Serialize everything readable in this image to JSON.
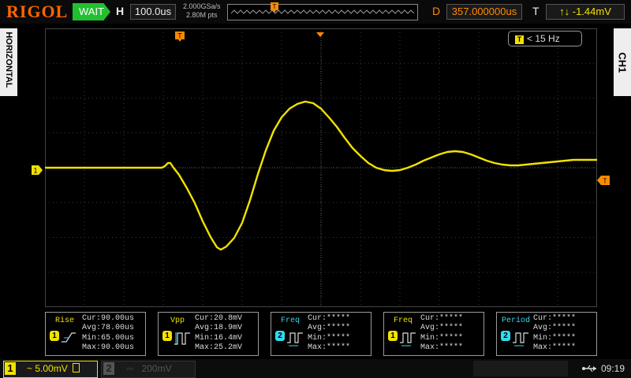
{
  "header": {
    "brand": "RIGOL",
    "run_state": "WAIT",
    "horizontal_label": "H",
    "timebase": "100.0us",
    "sample_rate": "2.000GSa/s",
    "memory_depth": "2.80M pts",
    "delay_label": "D",
    "delay_value": "357.000000us",
    "trigger_label": "T",
    "trigger_icon": "trigger-edge-icon",
    "trigger_level": "-1.44mV"
  },
  "side": {
    "left_tab": "HORIZONTAL",
    "right_tab": "CH1"
  },
  "screen": {
    "trigger_marker": "T",
    "freq_counter": "< 15 Hz",
    "ch1_marker": "1",
    "colors": {
      "ch1": "#f2e200",
      "ch2": "#33d9f0",
      "trigger": "#ff8a00",
      "grid": "#3a3a3a"
    }
  },
  "measurements": [
    {
      "name": "Rise",
      "channel": "1",
      "icon": "rise-time-icon",
      "cur": "Cur:90.00us",
      "avg": "Avg:78.00us",
      "min": "Min:65.00us",
      "max": "Max:90.00us"
    },
    {
      "name": "Vpp",
      "channel": "1",
      "icon": "peak-to-peak-icon",
      "cur": "Cur:20.8mV",
      "avg": "Avg:18.9mV",
      "min": "Min:16.4mV",
      "max": "Max:25.2mV"
    },
    {
      "name": "Freq",
      "channel": "2",
      "icon": "frequency-icon",
      "cur": "Cur:*****",
      "avg": "Avg:*****",
      "min": "Min:*****",
      "max": "Max:*****"
    },
    {
      "name": "Freq",
      "channel": "1",
      "icon": "frequency-icon",
      "cur": "Cur:*****",
      "avg": "Avg:*****",
      "min": "Min:*****",
      "max": "Max:*****"
    },
    {
      "name": "Period",
      "channel": "2",
      "icon": "period-icon",
      "cur": "Cur:*****",
      "avg": "Avg:*****",
      "min": "Min:*****",
      "max": "Max:*****"
    }
  ],
  "footer": {
    "ch1_number": "1",
    "ch1_scale": "~ 5.00mV",
    "ch2_number": "2",
    "ch2_scale": "200mV",
    "clock": "09:19",
    "usb_icon": "usb-icon"
  }
}
